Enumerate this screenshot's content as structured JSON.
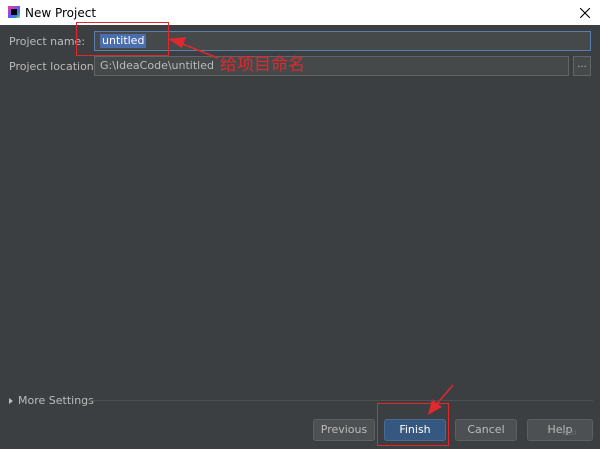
{
  "window": {
    "title": "New Project"
  },
  "form": {
    "name_label": "Project name:",
    "name_value": "untitled",
    "location_label": "Project location:",
    "location_value": "G:\\IdeaCode\\untitled",
    "browse_label": "..."
  },
  "annotation": {
    "text": "给项目命名",
    "color": "#e0282f"
  },
  "more_settings": {
    "label": "More Settings"
  },
  "buttons": {
    "previous": "Previous",
    "finish": "Finish",
    "cancel": "Cancel",
    "help": "Help"
  },
  "watermark": "ooo",
  "colors": {
    "background": "#3c3f41",
    "accent": "#365880",
    "selection": "#4b6eaf",
    "annotation": "#e0282f"
  },
  "icons": [
    "idea-app-icon",
    "close-icon",
    "expand-triangle-icon",
    "annotation-arrow-icon"
  ]
}
